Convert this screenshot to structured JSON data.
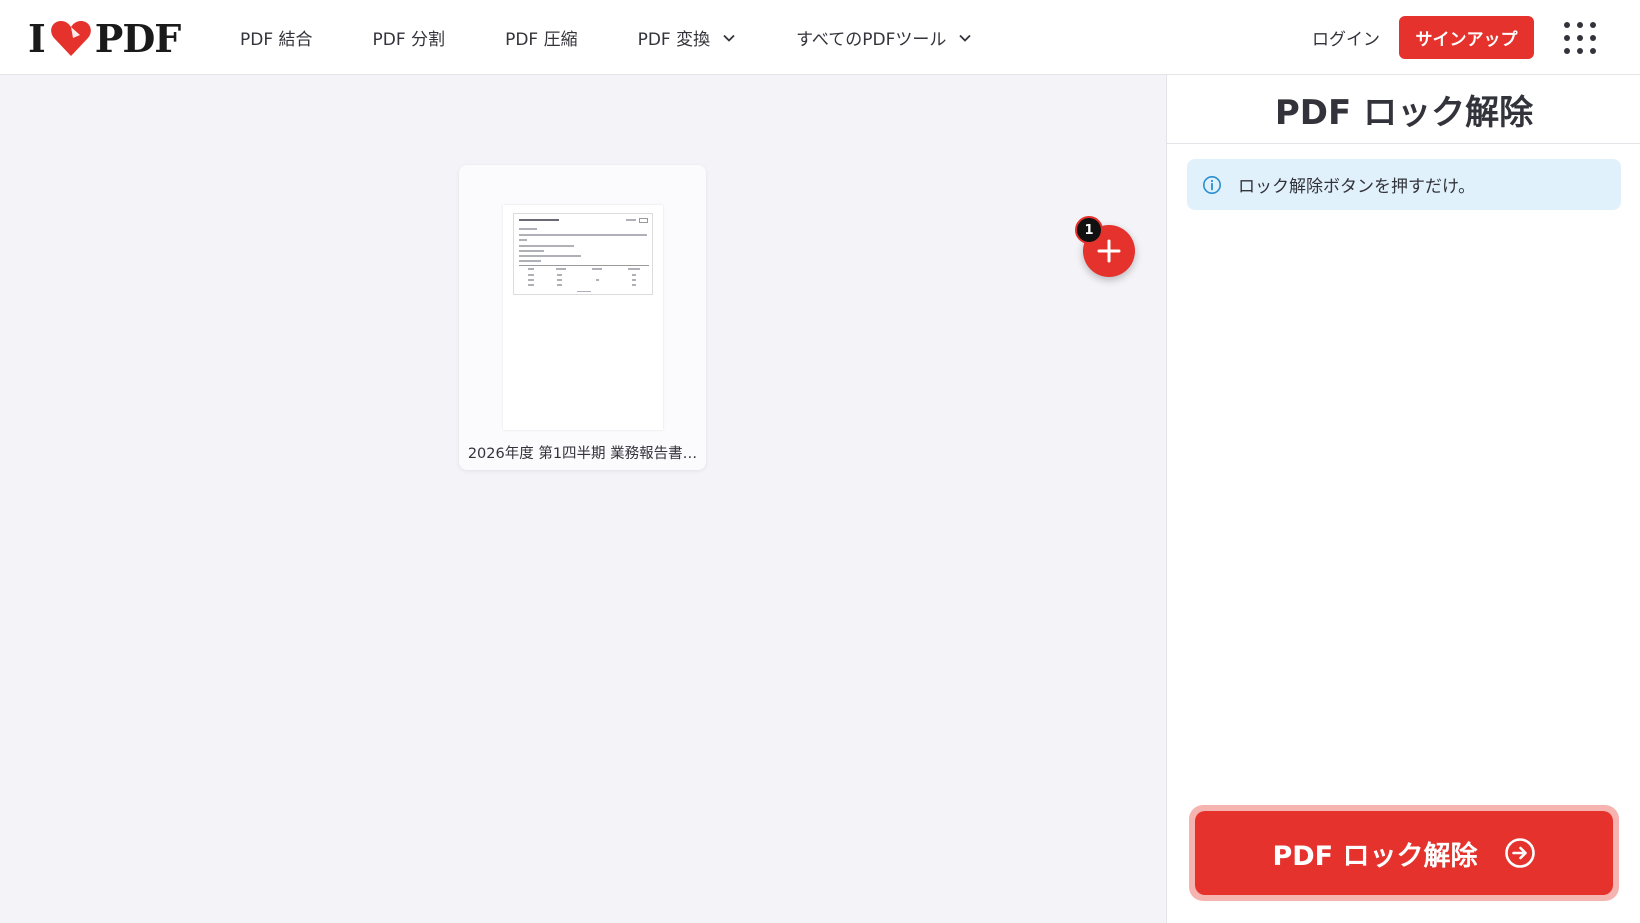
{
  "header": {
    "logo_left": "I",
    "logo_right": "PDF",
    "nav": [
      {
        "label": "PDF 結合"
      },
      {
        "label": "PDF 分割"
      },
      {
        "label": "PDF 圧縮"
      },
      {
        "label": "PDF 変換"
      },
      {
        "label": "すべてのPDFツール"
      }
    ],
    "login_label": "ログイン",
    "signup_label": "サインアップ"
  },
  "workspace": {
    "file": {
      "name": "2026年度 第1四半期 業務報告書…"
    },
    "file_count": "1"
  },
  "sidebar": {
    "title": "PDF ロック解除",
    "info_text": "ロック解除ボタンを押すだけ。",
    "action_label": "PDF ロック解除"
  },
  "colors": {
    "brand": "#e5322d",
    "info_bg": "#e1f1fb",
    "info_icon": "#2a8fd0"
  }
}
